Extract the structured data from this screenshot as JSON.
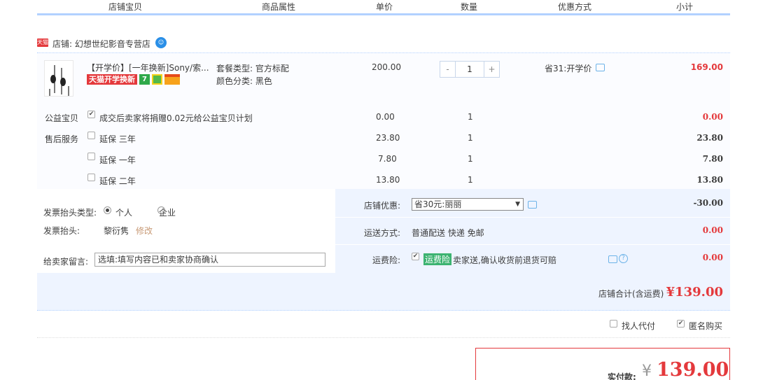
{
  "header": {
    "col_item": "店铺宝贝",
    "col_attr": "商品属性",
    "col_price": "单价",
    "col_qty": "数量",
    "col_discount": "优惠方式",
    "col_subtotal": "小计"
  },
  "shop": {
    "logo": "天猫",
    "name": "店铺: 幻想世纪影音专营店"
  },
  "item": {
    "title": "【开学价】[一年换新]Sony/索...",
    "badge": "天猫开学换新",
    "badge_seven": "7",
    "attr_package": "套餐类型: 官方标配",
    "attr_color": "颜色分类: 黑色",
    "price": "200.00",
    "qty": "1",
    "minus": "-",
    "plus": "+",
    "discount": "省31:开学价",
    "subtotal": "169.00"
  },
  "charity": {
    "label": "公益宝贝",
    "text": "成交后卖家将捐赠0.02元给公益宝贝计划",
    "price": "0.00",
    "qty": "1",
    "subtotal": "0.00"
  },
  "aftersale": {
    "label": "售后服务",
    "options": [
      {
        "text": "延保 三年",
        "price": "23.80",
        "qty": "1",
        "subtotal": "23.80"
      },
      {
        "text": "延保 一年",
        "price": "7.80",
        "qty": "1",
        "subtotal": "7.80"
      },
      {
        "text": "延保 二年",
        "price": "13.80",
        "qty": "1",
        "subtotal": "13.80"
      }
    ]
  },
  "invoice": {
    "type_label": "发票抬头类型:",
    "opt_personal": "个人",
    "opt_company": "企业",
    "title_label": "发票抬头:",
    "title_value": "黎衍隽",
    "edit": "修改"
  },
  "message": {
    "label": "给卖家留言:",
    "placeholder": "选填:填写内容已和卖家协商确认"
  },
  "shop_discount": {
    "label": "店铺优惠:",
    "selected": "省30元:丽丽",
    "amount": "-30.00"
  },
  "shipping": {
    "label": "运送方式:",
    "value": "普通配送 快递 免邮",
    "amount": "0.00"
  },
  "insurance": {
    "label": "运费险:",
    "tag": "运费险",
    "text": "卖家送,确认收货前退货可赔",
    "amount": "0.00"
  },
  "total": {
    "label": "店铺合计(含运费)",
    "amount": "¥139.00"
  },
  "agent": {
    "proxy": "找人代付",
    "anonymous": "匿名购买"
  },
  "pay": {
    "label": "实付款:",
    "currency": "¥",
    "amount": "139.00"
  },
  "colors": {
    "accent_red": "#e4393c",
    "header_border": "#b2d1ff",
    "panel_bg": "#eef4ff"
  }
}
